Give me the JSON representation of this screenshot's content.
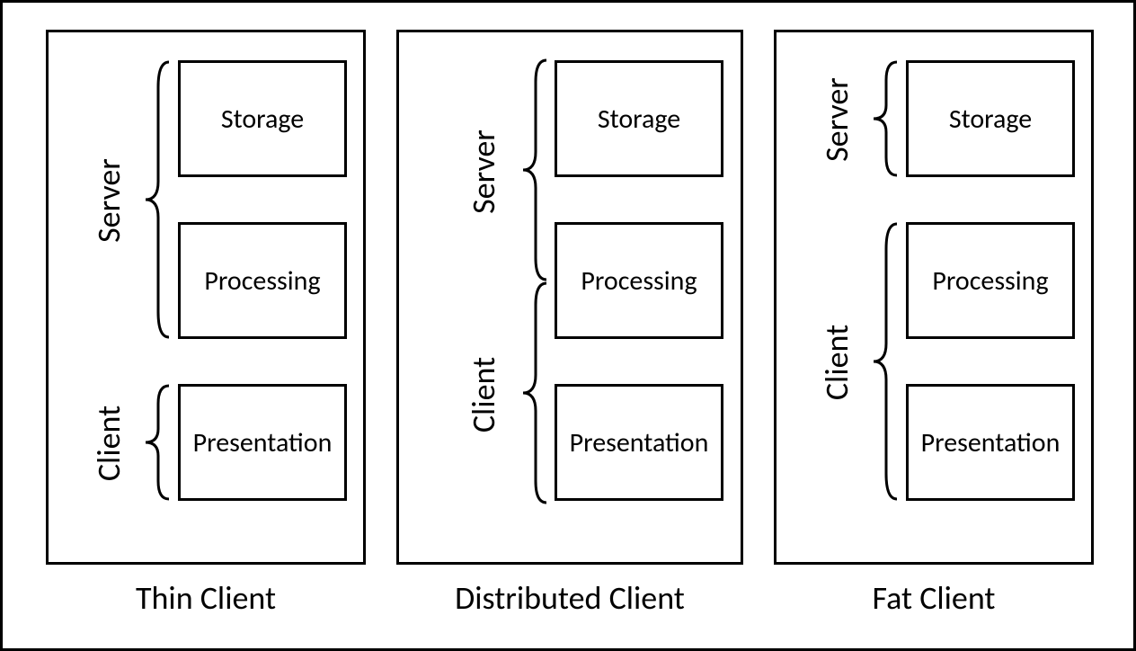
{
  "layers": {
    "storage": "Storage",
    "processing": "Processing",
    "presentation": "Presentation"
  },
  "roles": {
    "server": "Server",
    "client": "Client"
  },
  "columns": {
    "thin": {
      "caption": "Thin Client"
    },
    "distributed": {
      "caption": "Distributed Client"
    },
    "fat": {
      "caption": "Fat Client"
    }
  }
}
